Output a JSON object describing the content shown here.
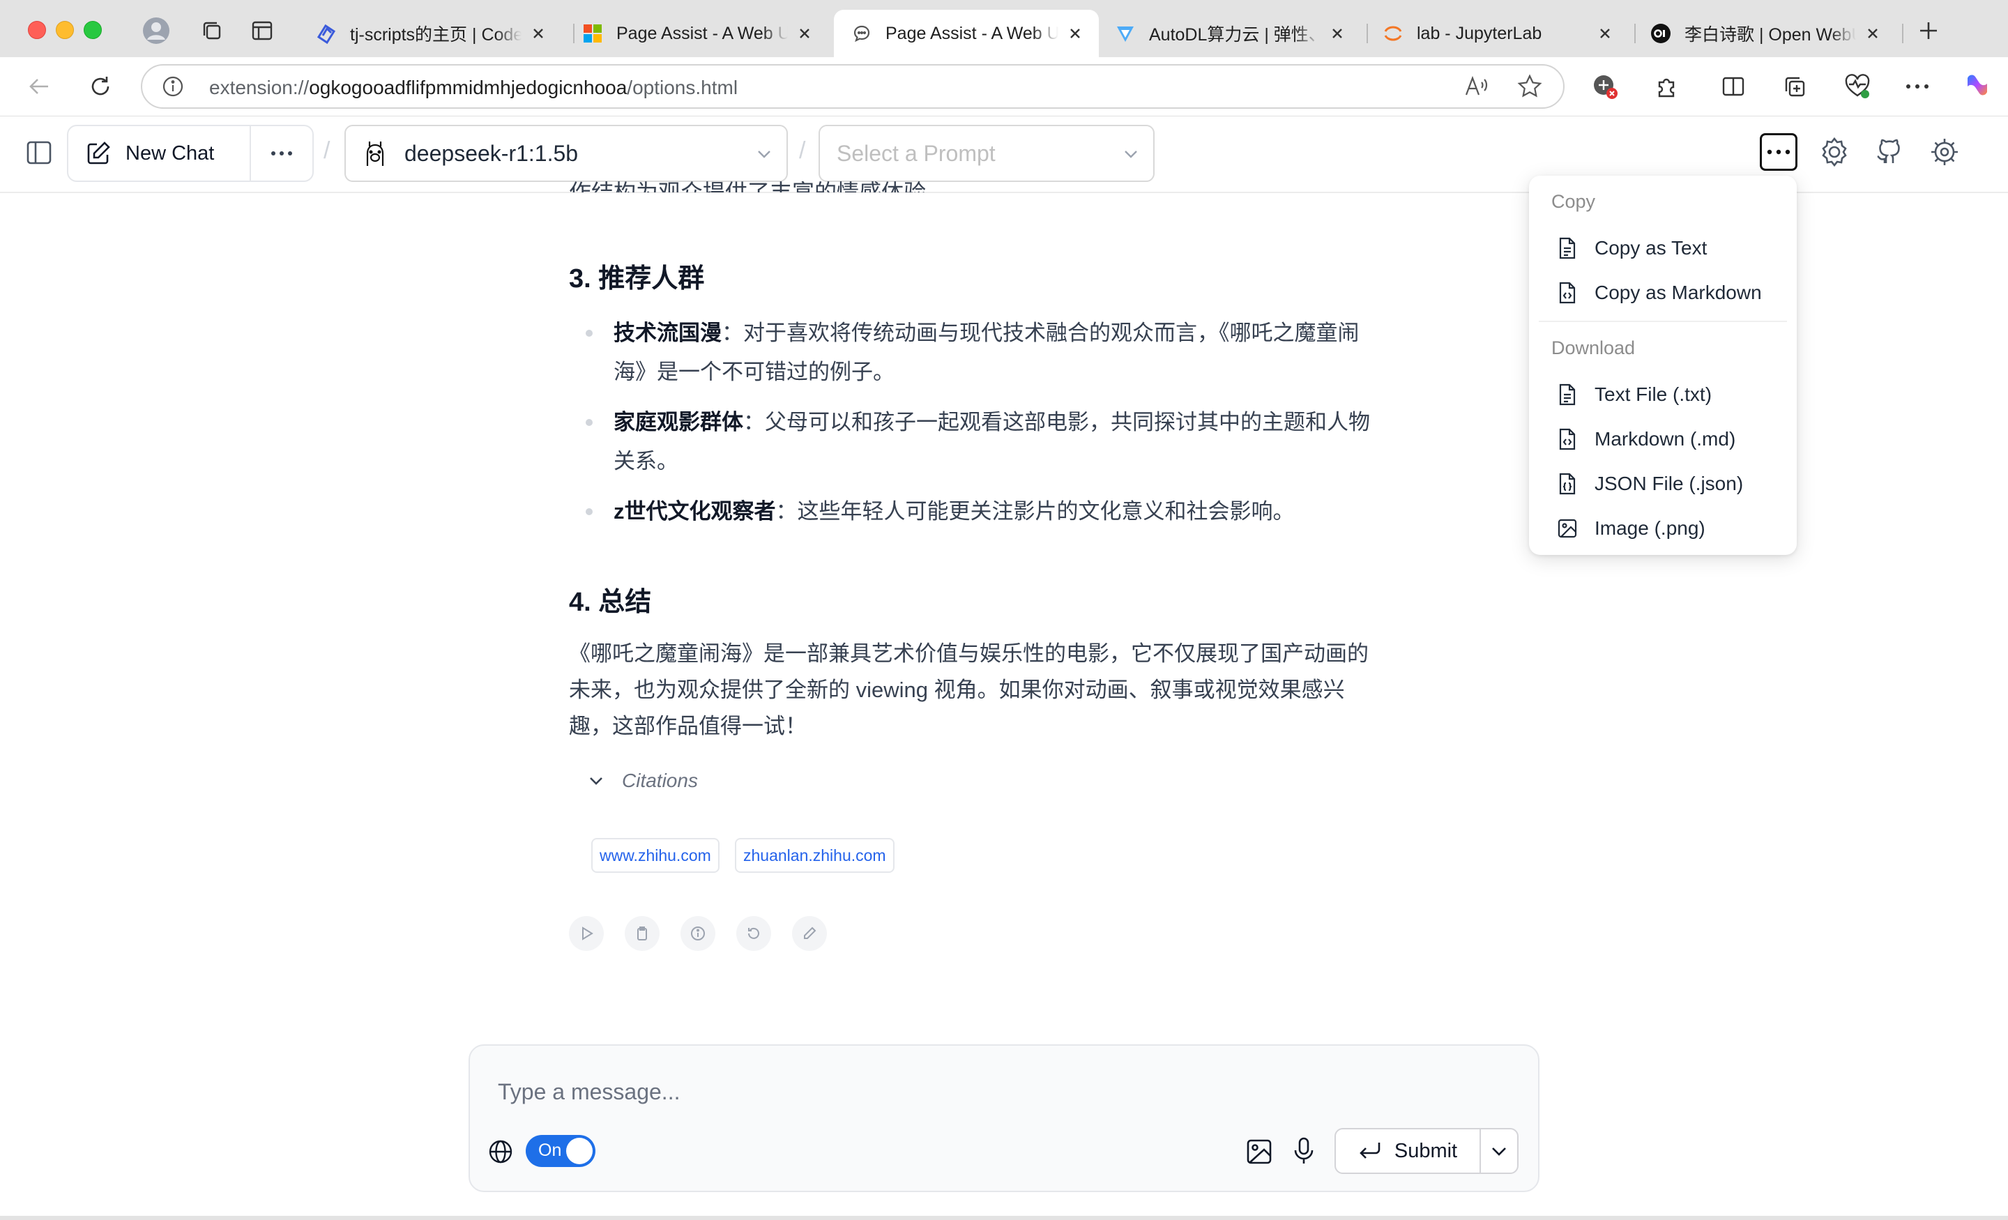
{
  "browser": {
    "tabs": [
      {
        "title": "tj-scripts的主页 | CodeW",
        "favicon": "codewaves-icon",
        "active": false
      },
      {
        "title": "Page Assist - A Web UI",
        "favicon": "microsoft-icon",
        "active": false
      },
      {
        "title": "Page Assist - A Web UI",
        "favicon": "chat-bubble-icon",
        "active": true
      },
      {
        "title": "AutoDL算力云 | 弹性、好",
        "favicon": "autodl-icon",
        "active": false
      },
      {
        "title": "lab - JupyterLab",
        "favicon": "jupyter-icon",
        "active": false
      },
      {
        "title": "李白诗歌 | Open WebUI",
        "favicon": "openwebui-icon",
        "active": false
      }
    ],
    "address": {
      "scheme": "extension://",
      "host": "ogkogooadflifpmmidmhjedogicnhooa",
      "path": "/options.html"
    }
  },
  "app": {
    "new_chat_label": "New Chat",
    "model_name": "deepseek-r1:1.5b",
    "prompt_placeholder": "Select a Prompt",
    "separator": "/"
  },
  "menu": {
    "copy_header": "Copy",
    "copy_items": [
      "Copy as Text",
      "Copy as Markdown"
    ],
    "download_header": "Download",
    "download_items": [
      "Text File (.txt)",
      "Markdown (.md)",
      "JSON File (.json)",
      "Image (.png)"
    ]
  },
  "message": {
    "clipped_line": "作结构为观众提供了丰富的情感体验。",
    "section3_title": "3. 推荐人群",
    "bullets": [
      {
        "bold": "技术流国漫",
        "text": "：对于喜欢将传统动画与现代技术融合的观众而言，《哪吒之魔童闹海》是一个不可错过的例子。"
      },
      {
        "bold": "家庭观影群体",
        "text": "：父母可以和孩子一起观看这部电影，共同探讨其中的主题和人物关系。"
      },
      {
        "bold": "z世代文化观察者",
        "text": "：这些年轻人可能更关注影片的文化意义和社会影响。"
      }
    ],
    "section4_title": "4. 总结",
    "summary": "《哪吒之魔童闹海》是一部兼具艺术价值与娱乐性的电影，它不仅展现了国产动画的未来，也为观众提供了全新的 viewing 视角。如果你对动画、叙事或视觉效果感兴趣，这部作品值得一试！",
    "citations_label": "Citations",
    "citations": [
      "www.zhihu.com",
      "zhuanlan.zhihu.com"
    ]
  },
  "composer": {
    "placeholder": "Type a message...",
    "web_search_toggle": "On",
    "submit_label": "Submit"
  },
  "colors": {
    "accent": "#1e6fe8",
    "link": "#2563eb",
    "tabstrip": "#e3e3e3"
  }
}
